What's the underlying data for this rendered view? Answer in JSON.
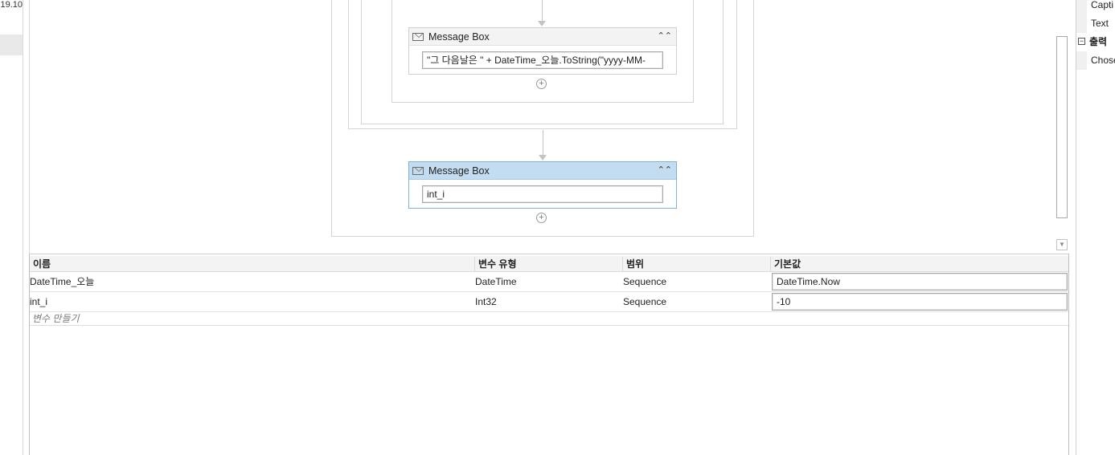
{
  "left_panel": {
    "version_fragment": "19.10"
  },
  "designer": {
    "message_box_1": {
      "title": "Message Box",
      "collapse_glyph": "⌃⌃",
      "text_value": "\"그 다음날은 \" + DateTime_오늘.ToString(\"yyyy-MM-"
    },
    "message_box_2": {
      "title": "Message Box",
      "collapse_glyph": "⌃⌃",
      "text_value": "int_i"
    },
    "add_glyph": "+"
  },
  "variables": {
    "columns": [
      "이름",
      "변수 유형",
      "범위",
      "기본값"
    ],
    "rows": [
      {
        "name": "DateTime_오늘",
        "type": "DateTime",
        "scope": "Sequence",
        "default": "DateTime.Now"
      },
      {
        "name": "int_i",
        "type": "Int32",
        "scope": "Sequence",
        "default": "-10"
      }
    ],
    "create_placeholder": "변수 만들기"
  },
  "properties": {
    "rows": [
      {
        "label": "Capti"
      },
      {
        "label": "Text"
      }
    ],
    "section": {
      "toggle": "−",
      "label": "출력"
    },
    "output_rows": [
      {
        "label": "Chose"
      }
    ]
  },
  "colors": {
    "selected_header": "#c3dcf0",
    "selected_border": "#7fb0d8",
    "frame_border": "#d4d4d4"
  }
}
